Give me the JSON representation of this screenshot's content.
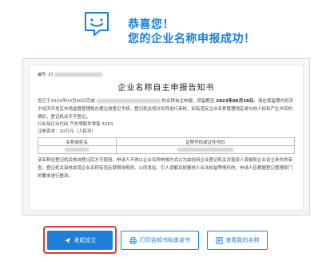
{
  "header": {
    "title_line1": "恭喜您！",
    "title_line2": "您的企业名称申报成功！"
  },
  "notice": {
    "code_label": "编号:",
    "code_value": "37",
    "doc_title": "企业名称自主申报告知书",
    "p1_a": "您已于2023年03月20日完成",
    "p1_b": "的名称自主申报，保留期至",
    "p1_date": "2023年05月19日",
    "p1_c": "。请在保留期内到济宁经济开发区市场监督管理局办理注册登记手续。登记机关将对名称进行审核，如有违反企业名称管理规定或与他人权利产生冲突的情形，登记机关不予登记。",
    "industry": "行业及行业代码    汽车零配件零售 5263",
    "capital": "注册资本：10万元（人民币）",
    "table_headers": [
      "名称或姓名",
      "证照号码或证件号码"
    ],
    "p2": "该名称经登记机关核准登记后方可使用。申请人不得以企业名称申报方式以为由抗辩企业登记机关对投资人资格和企业设立条件的审查。登记机关审核发现企业名称有违反禁限用规则、公序良俗、引人误解及损害他人合法权益等情形的，申请人应根据登记管理部门的要求进行整改。"
  },
  "buttons": {
    "start": "发起设立",
    "print": "打印告知书和承诺书",
    "view": "查看我的名称"
  },
  "colors": {
    "brand": "#1d7fd7",
    "highlight": "#e53935"
  }
}
